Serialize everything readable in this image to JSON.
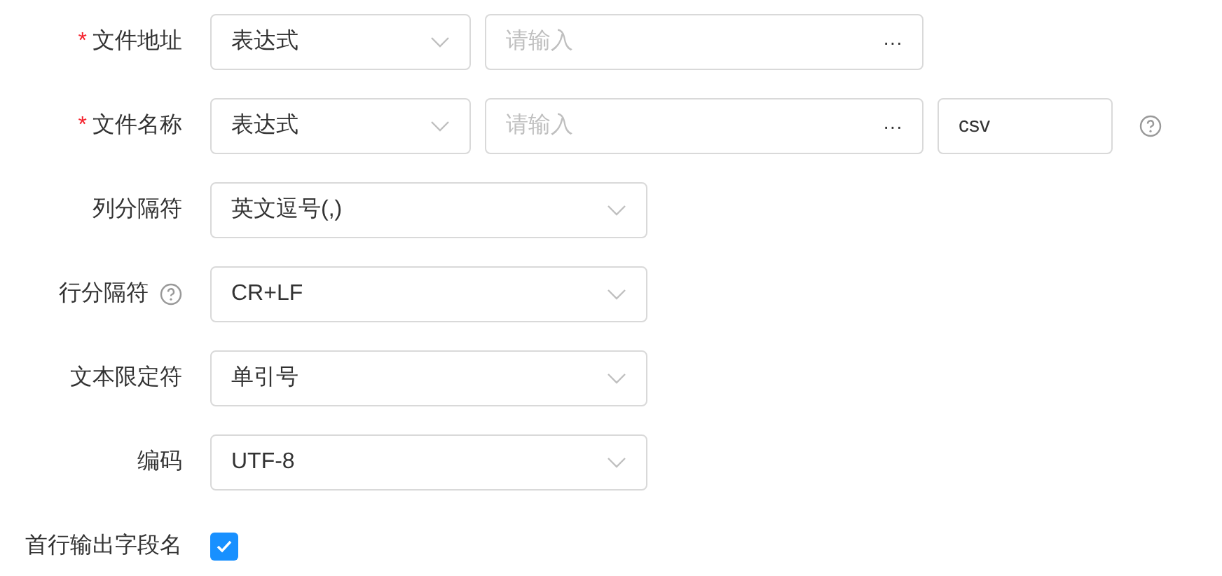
{
  "fields": [
    {
      "kind": "expression",
      "label": "文件地址",
      "required_mark": "*",
      "mode": "表达式",
      "placeholder": "请输入",
      "more": "···"
    },
    {
      "kind": "expression",
      "label": "文件名称",
      "required_mark": "*",
      "mode": "表达式",
      "placeholder": "请输入",
      "more": "···",
      "extension": "csv",
      "extension_help": true
    },
    {
      "kind": "select",
      "label": "列分隔符",
      "value": "英文逗号(,)"
    },
    {
      "kind": "select",
      "label": "行分隔符",
      "help": true,
      "value": "CR+LF"
    },
    {
      "kind": "select",
      "label": "文本限定符",
      "value": "单引号"
    },
    {
      "kind": "select",
      "label": "编码",
      "value": "UTF-8"
    },
    {
      "kind": "checkbox",
      "label": "首行输出字段名",
      "checked": true
    }
  ]
}
